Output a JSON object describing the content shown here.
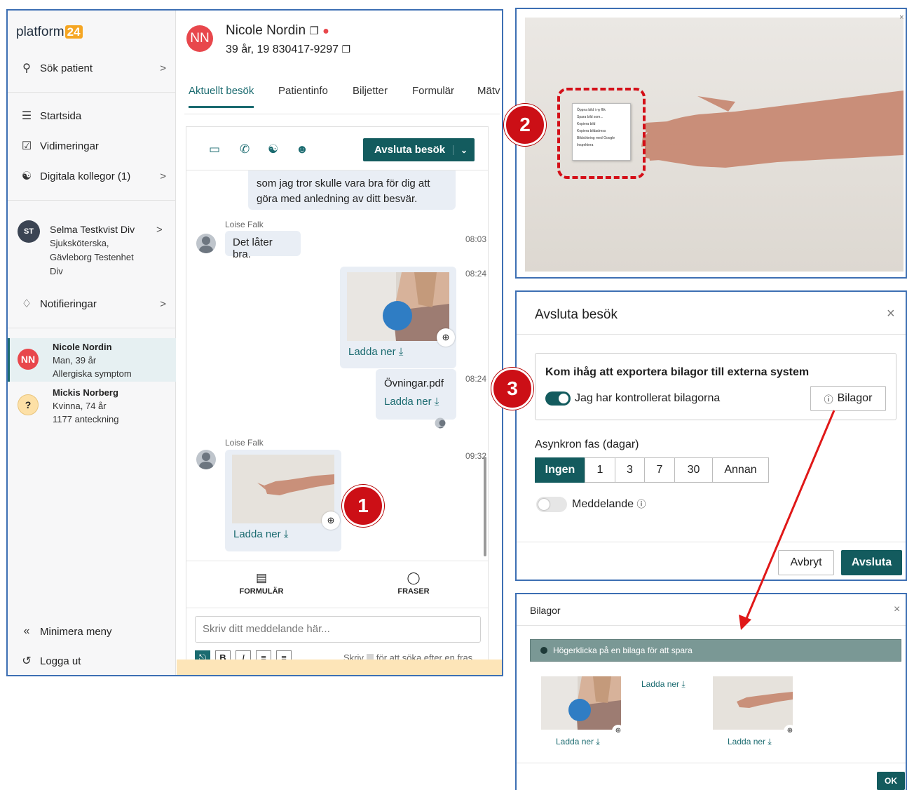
{
  "app": {
    "logo": {
      "text": "platform",
      "num": "24"
    },
    "sidebar": {
      "search": {
        "icon": "search-icon",
        "label": "Sök patient"
      },
      "items": [
        {
          "icon": "list-icon",
          "label": "Startsida"
        },
        {
          "icon": "checkbox-icon",
          "label": "Vidimeringar"
        },
        {
          "icon": "people-icon",
          "label": "Digitala kollegor (1)"
        }
      ],
      "staff": {
        "initials": "ST",
        "name": "Selma Testkvist Div",
        "line2": "Sjuksköterska,",
        "line3": "Gävleborg Testenhet",
        "line4": "Div"
      },
      "notifications": {
        "icon": "bell-icon",
        "label": "Notifieringar"
      },
      "patients": [
        {
          "initials": "NN",
          "name": "Nicole Nordin",
          "line2": "Man, 39 år",
          "line3": "Allergiska symptom",
          "color": "#e8474c"
        },
        {
          "initials": "?",
          "name": "Mickis Norberg",
          "line2": "Kvinna, 74 år",
          "line3": "1177 anteckning",
          "color": "#fde0a6"
        }
      ],
      "minimize": "Minimera meny",
      "logout": "Logga ut"
    },
    "header": {
      "initials": "NN",
      "name": "Nicole Nordin",
      "sub": "39 år, 19 830417-9297"
    },
    "tabs": [
      "Aktuellt besök",
      "Patientinfo",
      "Biljetter",
      "Formulär",
      "Mätv"
    ],
    "toolbar": {
      "end_visit": "Avsluta besök"
    },
    "chat": {
      "msg_top": "som jag tror skulle vara bra för dig att göra med anledning av ditt besvär.",
      "sender1": "Loise Falk",
      "msg1": "Det låter bra.",
      "time1": "08:03",
      "time2": "08:24",
      "download": "Ladda ner",
      "time3": "08:24",
      "file_name": "Övningar.pdf",
      "sender2": "Loise Falk",
      "time4": "09:32"
    },
    "bottom": {
      "forms": "FORMULÄR",
      "phrases": "FRASER"
    },
    "input_placeholder": "Skriv ditt meddelande här...",
    "hint_before": "Skriv",
    "hint_after": "för att söka efter en fras"
  },
  "badges": [
    "1",
    "2",
    "3"
  ],
  "context_menu": [
    "Öppna bild i ny flik",
    "Spara bild som...",
    "Kopiera bild",
    "Kopiera bildadress",
    "Bildsökning med Google",
    "Inspektera"
  ],
  "end_dialog": {
    "title": "Avsluta besök",
    "reminder": "Kom ihåg att exportera bilagor till externa system",
    "checked_label": "Jag har kontrollerat bilagorna",
    "attachments_btn": "Bilagor",
    "async_label": "Asynkron fas (dagar)",
    "options": [
      "Ingen",
      "1",
      "3",
      "7",
      "30",
      "Annan"
    ],
    "selected": "Ingen",
    "message_label": "Meddelande",
    "cancel": "Avbryt",
    "confirm": "Avsluta"
  },
  "attachments_dialog": {
    "title": "Bilagor",
    "info": "Högerklicka på en bilaga för att spara",
    "download": "Ladda ner",
    "ok": "OK"
  },
  "colors": {
    "brand": "#135b5e",
    "accent_red": "#cc0f16",
    "frame_border": "#3d6fb3"
  }
}
